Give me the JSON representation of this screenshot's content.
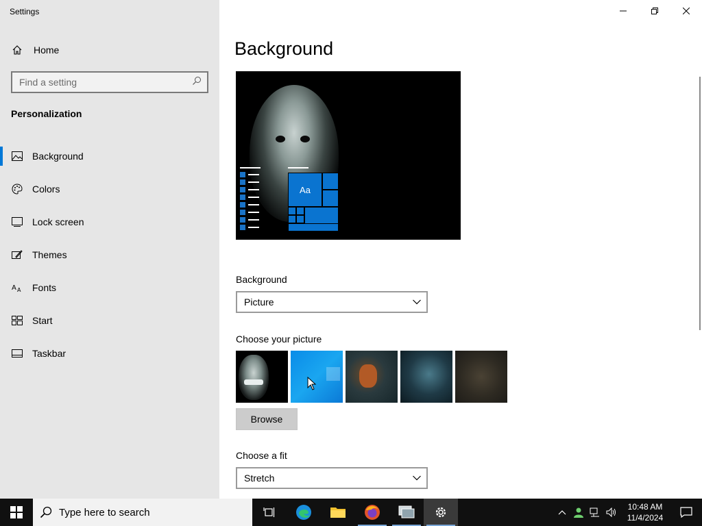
{
  "window": {
    "title": "Settings"
  },
  "sidebar": {
    "home_label": "Home",
    "search_placeholder": "Find a setting",
    "section_title": "Personalization",
    "items": [
      {
        "label": "Background",
        "icon": "picture-icon",
        "active": true
      },
      {
        "label": "Colors",
        "icon": "palette-icon",
        "active": false
      },
      {
        "label": "Lock screen",
        "icon": "lock-screen-icon",
        "active": false
      },
      {
        "label": "Themes",
        "icon": "themes-icon",
        "active": false
      },
      {
        "label": "Fonts",
        "icon": "fonts-icon",
        "active": false
      },
      {
        "label": "Start",
        "icon": "start-icon",
        "active": false
      },
      {
        "label": "Taskbar",
        "icon": "taskbar-icon",
        "active": false
      }
    ]
  },
  "main": {
    "title": "Background",
    "preview_tile_text": "Aa",
    "background_label": "Background",
    "background_value": "Picture",
    "choose_picture_label": "Choose your picture",
    "pictures": [
      "dark-face",
      "windows-blue",
      "fantasy-warrior",
      "blue-creature",
      "blurry-face"
    ],
    "browse_label": "Browse",
    "fit_label": "Choose a fit",
    "fit_value": "Stretch"
  },
  "taskbar": {
    "search_placeholder": "Type here to search",
    "apps": [
      "task-view",
      "edge",
      "file-explorer",
      "firefox",
      "network-tool",
      "settings"
    ],
    "clock_time": "10:48 AM",
    "clock_date": "11/4/2024"
  },
  "colors": {
    "accent": "#0078d7",
    "sidebar_bg": "#e6e6e6",
    "taskbar_bg": "#101010"
  }
}
